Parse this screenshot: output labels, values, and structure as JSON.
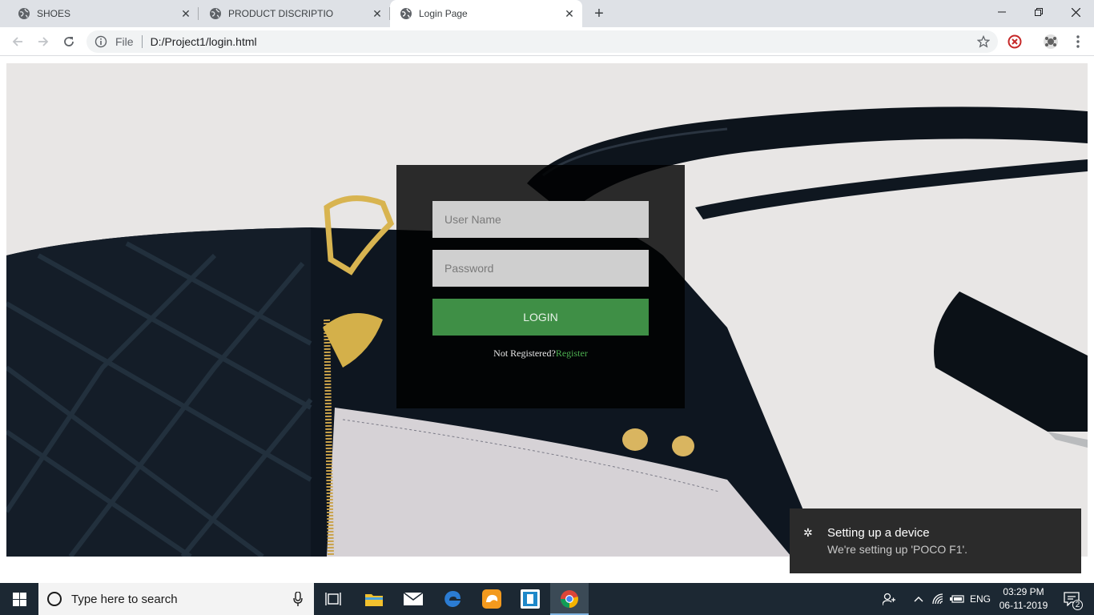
{
  "browser": {
    "tabs": [
      {
        "title": "SHOES"
      },
      {
        "title": "PRODUCT DISCRIPTIO"
      },
      {
        "title": "Login Page"
      }
    ],
    "address": {
      "scheme_label": "File",
      "url": "D:/Project1/login.html"
    }
  },
  "login": {
    "username_placeholder": "User Name",
    "password_placeholder": "Password",
    "login_label": "LOGIN",
    "not_registered": "Not Registered?",
    "register_link": "Register",
    "accent_color": "#3f8f46"
  },
  "toast": {
    "title": "Setting up a device",
    "message": "We're setting up 'POCO F1'."
  },
  "taskbar": {
    "search_placeholder": "Type here to search",
    "language": "ENG",
    "time": "03:29 PM",
    "date": "06-11-2019",
    "notification_count": "2"
  }
}
